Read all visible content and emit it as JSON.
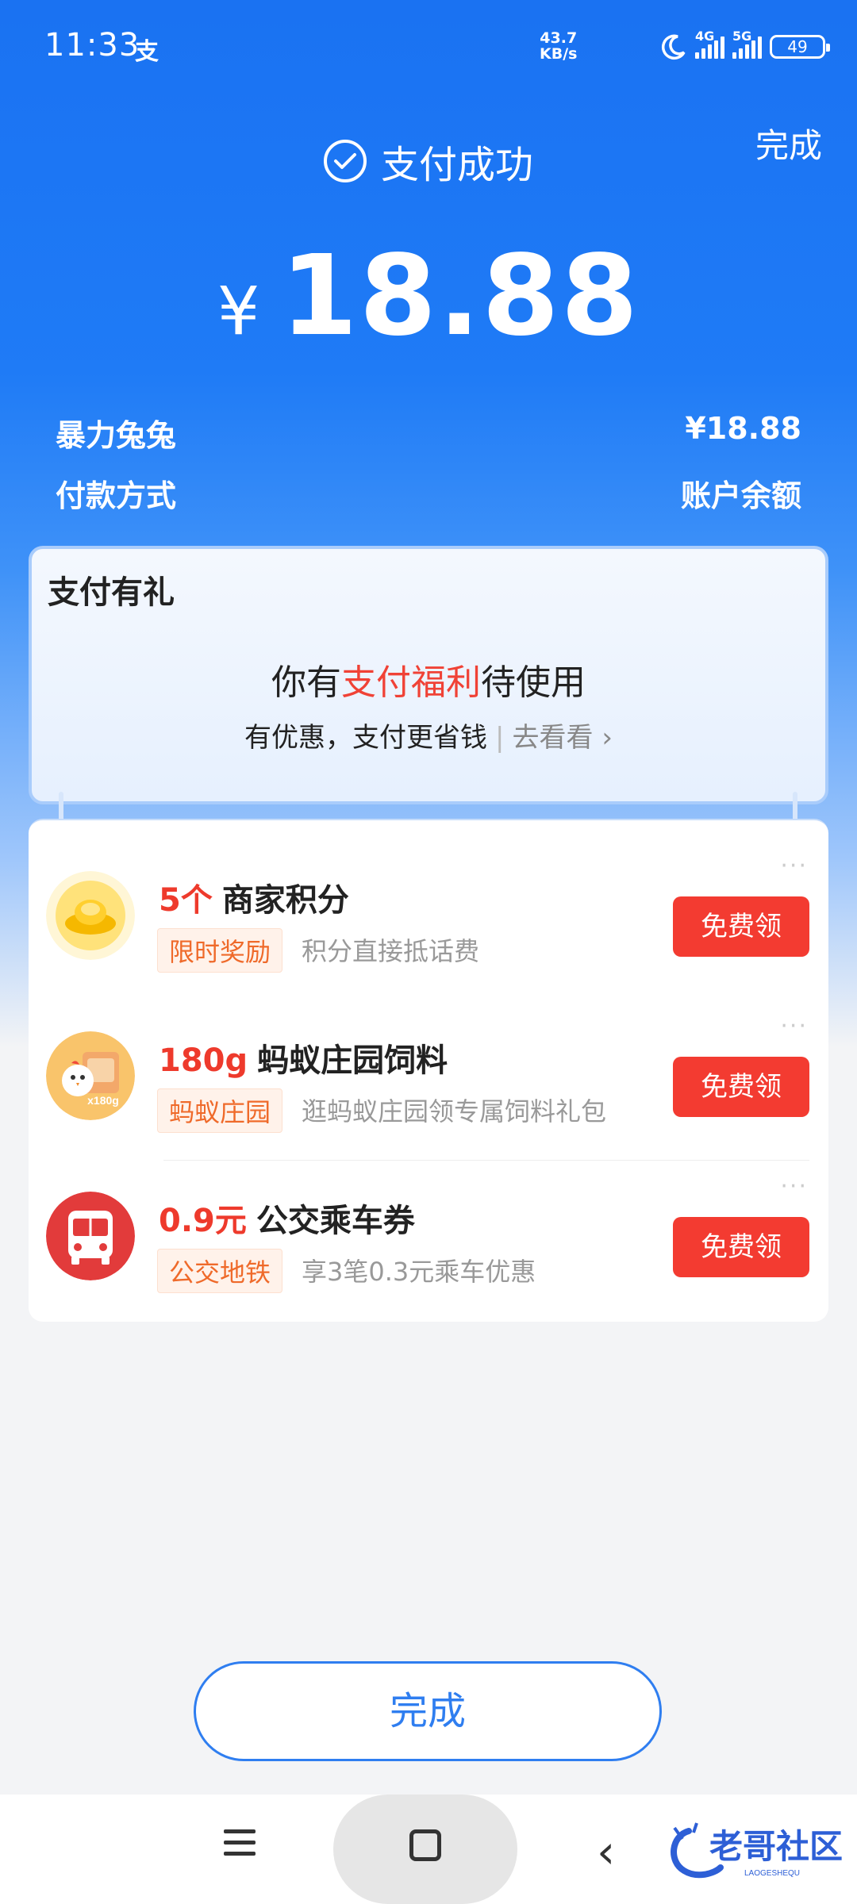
{
  "status_bar": {
    "time": "11:33",
    "app_indicator": "支",
    "net_speed_value": "43.7",
    "net_speed_unit": "KB/s",
    "sig1_label": "4G",
    "sig2_label": "5G",
    "battery": "49",
    "icons": [
      "moon-icon",
      "signal-4g-icon",
      "signal-5g-icon",
      "battery-icon"
    ]
  },
  "header": {
    "done_label": "完成",
    "title": "支付成功",
    "currency_symbol": "¥",
    "amount": "18.88"
  },
  "summary": {
    "merchant": "暴力兔兔",
    "merchant_amount": "¥18.88",
    "payment_method_label": "付款方式",
    "payment_method_value": "账户余额"
  },
  "gift": {
    "title": "支付有礼",
    "main_prefix": "你有",
    "main_highlight": "支付福利",
    "main_suffix": "待使用",
    "sub_text": "有优惠，支付更省钱",
    "link_text": "去看看"
  },
  "rewards": [
    {
      "quantity": "5个",
      "title": "商家积分",
      "tag": "限时奖励",
      "desc": "积分直接抵话费",
      "button": "免费领",
      "icon": "gold-ingot-icon"
    },
    {
      "quantity": "180g",
      "title": "蚂蚁庄园饲料",
      "tag": "蚂蚁庄园",
      "desc": "逛蚂蚁庄园领专属饲料礼包",
      "button": "免费领",
      "icon": "chick-feed-icon",
      "icon_badge": "x180g"
    },
    {
      "quantity": "0.9元",
      "title": "公交乘车券",
      "tag": "公交地铁",
      "desc": "享3笔0.3元乘车优惠",
      "button": "免费领",
      "icon": "bus-icon"
    }
  ],
  "more_dots": "···",
  "bottom": {
    "done_label": "完成"
  },
  "watermark": {
    "text": "老哥社区",
    "subtext": "LAOGESHEQU"
  },
  "colors": {
    "primary_blue": "#1f7bf6",
    "accent_red": "#f33b31",
    "tag_orange": "#ef6a2a"
  }
}
